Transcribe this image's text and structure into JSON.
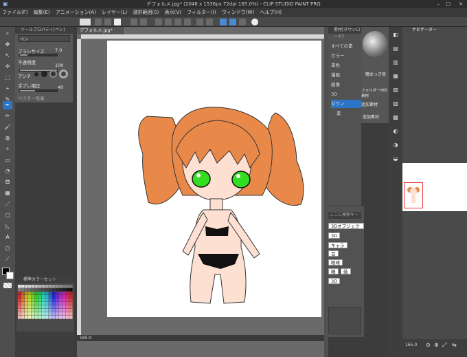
{
  "titlebar": {
    "title": "デフォルメ.jpg* (2048 x 1536px 72dpi 165.0%)  - CLIP STUDIO PAINT PRO"
  },
  "menu": [
    "ファイル(F)",
    "編集(E)",
    "アニメーション(A)",
    "レイヤー(L)",
    "選択範囲(S)",
    "表示(V)",
    "フィルター(I)",
    "ウィンドウ(W)",
    "ヘルプ(H)"
  ],
  "toolprop": {
    "header": "ツールプロパティ[ペン]",
    "subtool_label": "ペン",
    "brush_size_label": "ブラシサイズ",
    "brush_size_value": "7.0",
    "opacity_label": "不透明度",
    "opacity_value": "100",
    "aa_label": "アンチ",
    "stabilize_label": "手ブレ補正",
    "stabilize_value": "40",
    "vector_label": "ベクター吸着"
  },
  "colorset": {
    "header": "標準カラーセット"
  },
  "document": {
    "tab_label": "デフォルメ.jpg*"
  },
  "status": {
    "zoom": "165.0"
  },
  "material": {
    "header": "素材[ダウンロード]",
    "items": [
      "すべての素",
      "カラー",
      "単色",
      "漫画",
      "画像",
      "3D",
      "ダウン",
      "素"
    ],
    "thumb_label": "瞳おっき目",
    "folder_label": "フォルダー内の素材",
    "add_label": "追加素材",
    "add_label2": "追加素材"
  },
  "tags": {
    "header": "ここに検索キー",
    "items": [
      "3Dオブジェクト",
      "3D",
      "キャラ",
      "目",
      "眼球",
      "瞳",
      "鼓",
      "3D"
    ]
  },
  "navigator": {
    "tab_label": "ナビゲーター",
    "zoom": "165.0"
  },
  "colors": {
    "hair": "#e8894a",
    "eyes": "#33dd22",
    "skin": "#fde0d2",
    "accent": "#2b74c6"
  }
}
